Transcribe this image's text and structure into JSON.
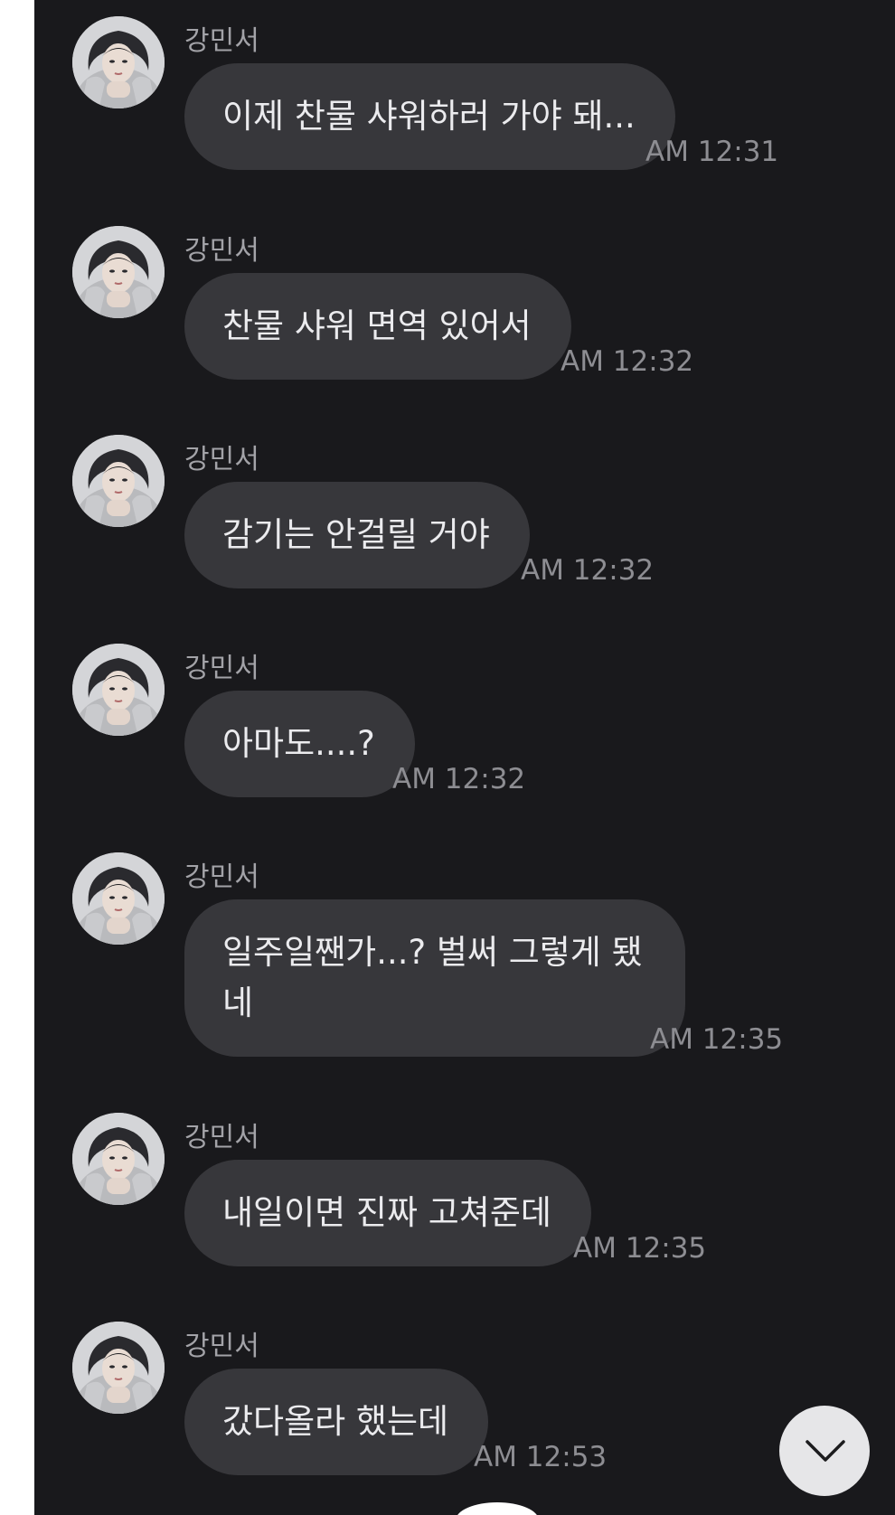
{
  "chat": {
    "messages": [
      {
        "sender": "강민서",
        "text": "이제 찬물 샤워하러 가야 돼...",
        "time": "AM 12:31"
      },
      {
        "sender": "강민서",
        "text": "찬물 샤워 면역 있어서",
        "time": "AM 12:32"
      },
      {
        "sender": "강민서",
        "text": "감기는 안걸릴 거야",
        "time": "AM 12:32"
      },
      {
        "sender": "강민서",
        "text": "아마도....?",
        "time": "AM 12:32"
      },
      {
        "sender": "강민서",
        "text": "일주일짼가...? 벌써 그렇게 됐네",
        "time": "AM 12:35"
      },
      {
        "sender": "강민서",
        "text": "내일이면 진짜 고쳐준데",
        "time": "AM 12:35"
      },
      {
        "sender": "강민서",
        "text": "갔다올라 했는데",
        "time": "AM 12:53"
      }
    ]
  },
  "icons": {
    "avatar": "profile-photo",
    "scroll_down": "chevron-down-icon"
  },
  "colors": {
    "background": "#19191c",
    "bubble": "#37373b",
    "bubble_text": "#ebebee",
    "sender_text": "#a3a3a8",
    "time_text": "#8d8d92",
    "scroll_button": "#e6e6e8"
  }
}
